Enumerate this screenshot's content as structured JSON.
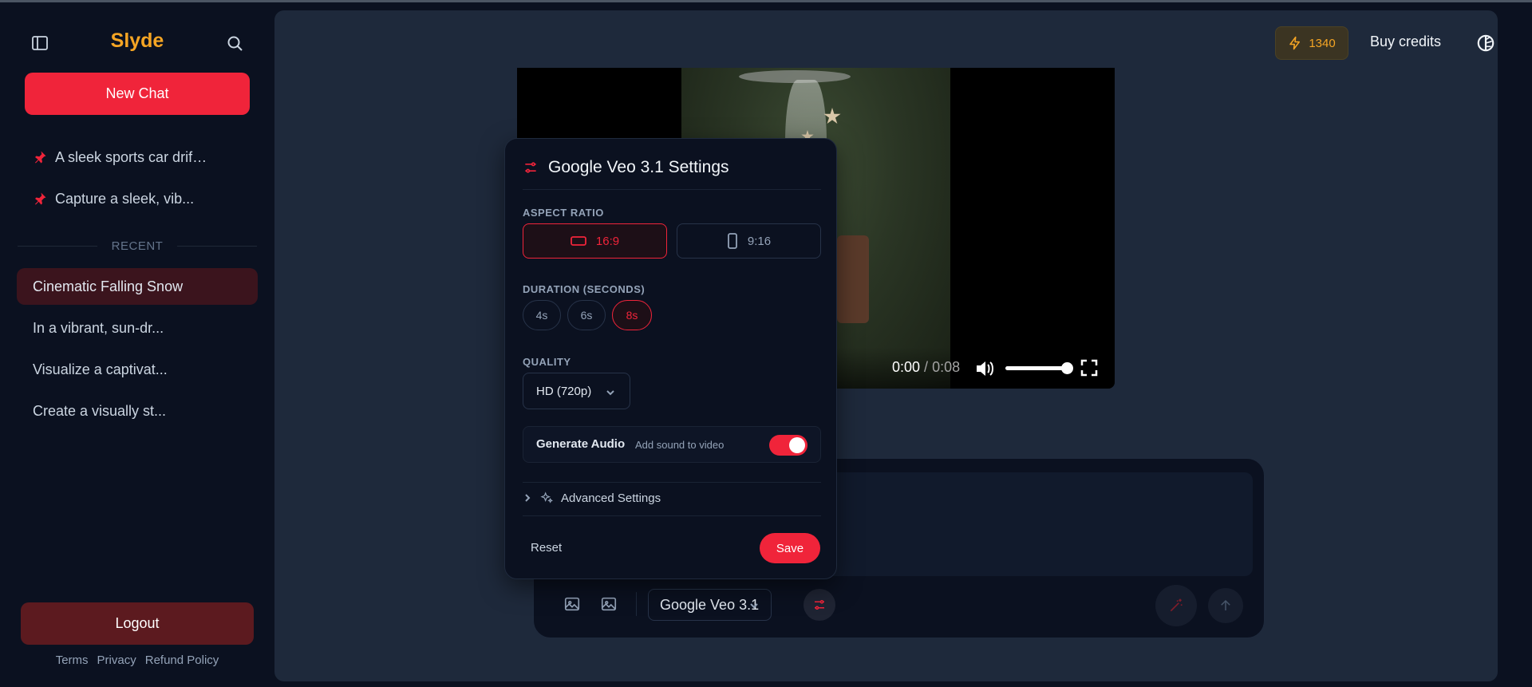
{
  "brand": "Slyde",
  "sidebar": {
    "new_chat_label": "New Chat",
    "pinned": [
      {
        "label": "A sleek sports car drif…",
        "icon": "pin-icon"
      },
      {
        "label": "Capture a sleek, vib...",
        "icon": "pin-icon"
      }
    ],
    "recent_label": "RECENT",
    "chats": [
      {
        "label": "Cinematic Falling Snow",
        "active": true
      },
      {
        "label": "In a vibrant, sun-dr..."
      },
      {
        "label": "Visualize a captivat..."
      },
      {
        "label": "Create a visually st..."
      }
    ],
    "logout_label": "Logout",
    "footer_links": [
      "Terms",
      "Privacy",
      "Refund Policy"
    ]
  },
  "header": {
    "credits": "1340",
    "buy_credits_label": "Buy credits"
  },
  "video": {
    "current_time": "0:00",
    "separator": " / ",
    "duration": "0:08",
    "volume": 1.0
  },
  "settings": {
    "title": "Google Veo 3.1 Settings",
    "aspect_ratio": {
      "label": "ASPECT RATIO",
      "options": [
        "16:9",
        "9:16"
      ],
      "selected": "16:9"
    },
    "duration": {
      "label": "DURATION (SECONDS)",
      "options": [
        "4s",
        "6s",
        "8s"
      ],
      "selected": "8s"
    },
    "quality": {
      "label": "QUALITY",
      "value": "HD (720p)"
    },
    "audio": {
      "title": "Generate Audio",
      "subtitle": "Add sound to video",
      "enabled": true
    },
    "advanced_label": "Advanced Settings",
    "reset_label": "Reset",
    "save_label": "Save"
  },
  "composer": {
    "model": "Google Veo 3.1"
  },
  "colors": {
    "accent": "#f0243a",
    "brand": "#f5a524",
    "background": "#0b1120",
    "panel": "#1e293b"
  }
}
